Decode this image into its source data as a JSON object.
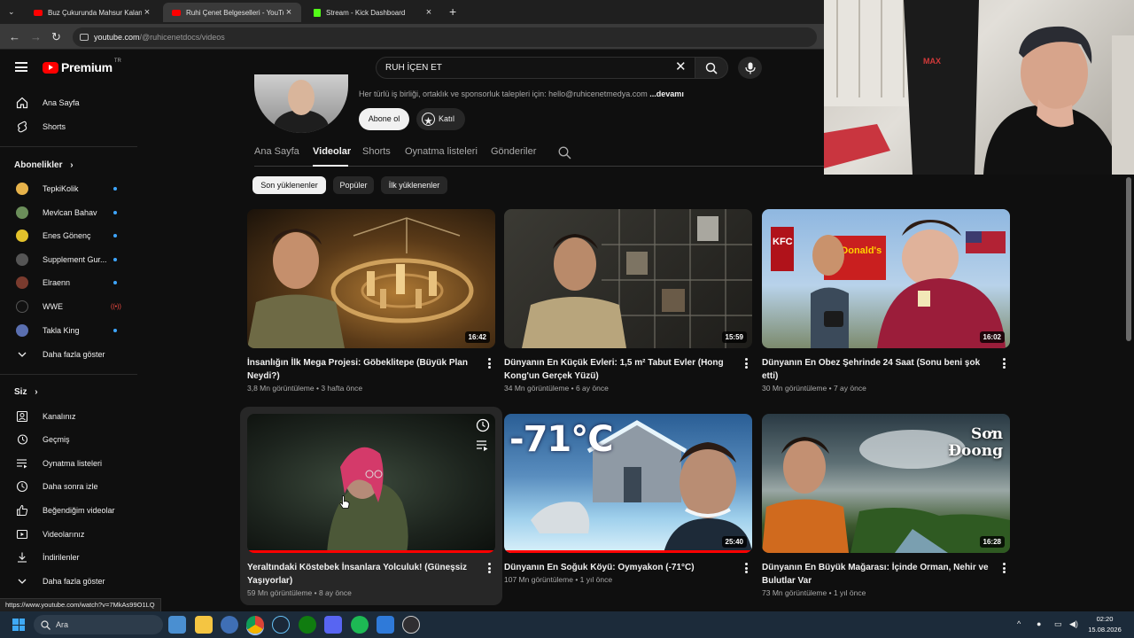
{
  "browser": {
    "tabs": [
      {
        "title": "Buz Çukurunda Mahsur Kalan Di",
        "active": false,
        "icon": "youtube-icon"
      },
      {
        "title": "Ruhi Çenet Belgeselleri - YouTube",
        "active": true,
        "icon": "youtube-icon"
      },
      {
        "title": "Stream - Kick Dashboard",
        "active": false,
        "icon": "kick-icon"
      }
    ],
    "url_host": "youtube.com",
    "url_path": "/@ruhicenetdocs/videos",
    "status_url": "https://www.youtube.com/watch?v=7MkAs99O1LQ"
  },
  "masthead": {
    "logo_text": "Premium",
    "country_code": "TR",
    "search_value": "RUH İÇEN ET"
  },
  "sidebar": {
    "main": [
      {
        "label": "Ana Sayfa",
        "icon": "home-icon"
      },
      {
        "label": "Shorts",
        "icon": "shorts-icon"
      }
    ],
    "subscriptions_title": "Abonelikler",
    "subscriptions": [
      {
        "label": "TepkiKolik",
        "color": "#e6b24a",
        "status": "new"
      },
      {
        "label": "Mevlcan Bahav",
        "color": "#6b8e5a",
        "status": "new"
      },
      {
        "label": "Enes Gönenç",
        "color": "#e3c22b",
        "status": "new"
      },
      {
        "label": "Supplement Gur...",
        "color": "#333333",
        "status": "new"
      },
      {
        "label": "Elraenn",
        "color": "#7a3b2e",
        "status": "new"
      },
      {
        "label": "WWE",
        "color": "#111111",
        "status": "live"
      },
      {
        "label": "Takla King",
        "color": "#5a6fb0",
        "status": "new"
      }
    ],
    "more_label": "Daha fazla göster",
    "you_title": "Siz",
    "you_items": [
      {
        "label": "Kanalınız",
        "icon": "account-icon"
      },
      {
        "label": "Geçmiş",
        "icon": "history-icon"
      },
      {
        "label": "Oynatma listeleri",
        "icon": "playlists-icon"
      },
      {
        "label": "Daha sonra izle",
        "icon": "watch-later-icon"
      },
      {
        "label": "Beğendiğim videolar",
        "icon": "like-icon"
      },
      {
        "label": "Videolarınız",
        "icon": "your-videos-icon"
      },
      {
        "label": "İndirilenler",
        "icon": "download-icon"
      },
      {
        "label": "Daha fazla göster",
        "icon": "chevron-down-icon"
      }
    ]
  },
  "channel": {
    "description": "Her türlü iş birliği, ortaklık ve sponsorluk talepleri için: hello@ruhicenetmedya.com",
    "more": "...devamı",
    "subscribe_label": "Abone ol",
    "join_label": "Katıl",
    "tabs": [
      "Ana Sayfa",
      "Videolar",
      "Shorts",
      "Oynatma listeleri",
      "Gönderiler"
    ],
    "active_tab": "Videolar"
  },
  "chips": [
    "Son yüklenenler",
    "Popüler",
    "İlk yüklenenler"
  ],
  "videos": [
    {
      "title": "İnsanlığın İlk Mega Projesi: Göbeklitepe (Büyük Plan Neydi?)",
      "views": "3,8 Mn görüntüleme",
      "age": "3 hafta önce",
      "duration": "16:42"
    },
    {
      "title": "Dünyanın En Küçük Evleri: 1,5 m² Tabut Evler (Hong Kong'un Gerçek Yüzü)",
      "views": "34 Mn görüntüleme",
      "age": "6 ay önce",
      "duration": "15:59"
    },
    {
      "title": "Dünyanın En Obez Şehrinde 24 Saat (Sonu beni şok etti)",
      "views": "30 Mn görüntüleme",
      "age": "7 ay önce",
      "duration": "16:02"
    },
    {
      "title": "Yeraltındaki Köstebek İnsanlara Yolculuk! (Güneşsiz Yaşıyorlar)",
      "views": "59 Mn görüntüleme",
      "age": "8 ay önce",
      "duration": ""
    },
    {
      "title": "Dünyanın En Soğuk Köyü: Oymyakon (-71°C)",
      "views": "107 Mn görüntüleme",
      "age": "1 yıl önce",
      "duration": "25:40"
    },
    {
      "title": "Dünyanın En Büyük Mağarası: İçinde Orman, Nehir ve Bulutlar Var",
      "views": "73 Mn görüntüleme",
      "age": "1 yıl önce",
      "duration": "16:28"
    }
  ],
  "thumb_text": {
    "cold": "-71°C",
    "cave_line1": "Sơn",
    "cave_line2": "Đoong",
    "brand1": "McDonald's",
    "brand2": "KFC"
  },
  "webcam": {
    "chair_brand": "MAX"
  },
  "taskbar": {
    "search_placeholder": "Ara",
    "time": "02:20",
    "date": "15.08.2026"
  }
}
